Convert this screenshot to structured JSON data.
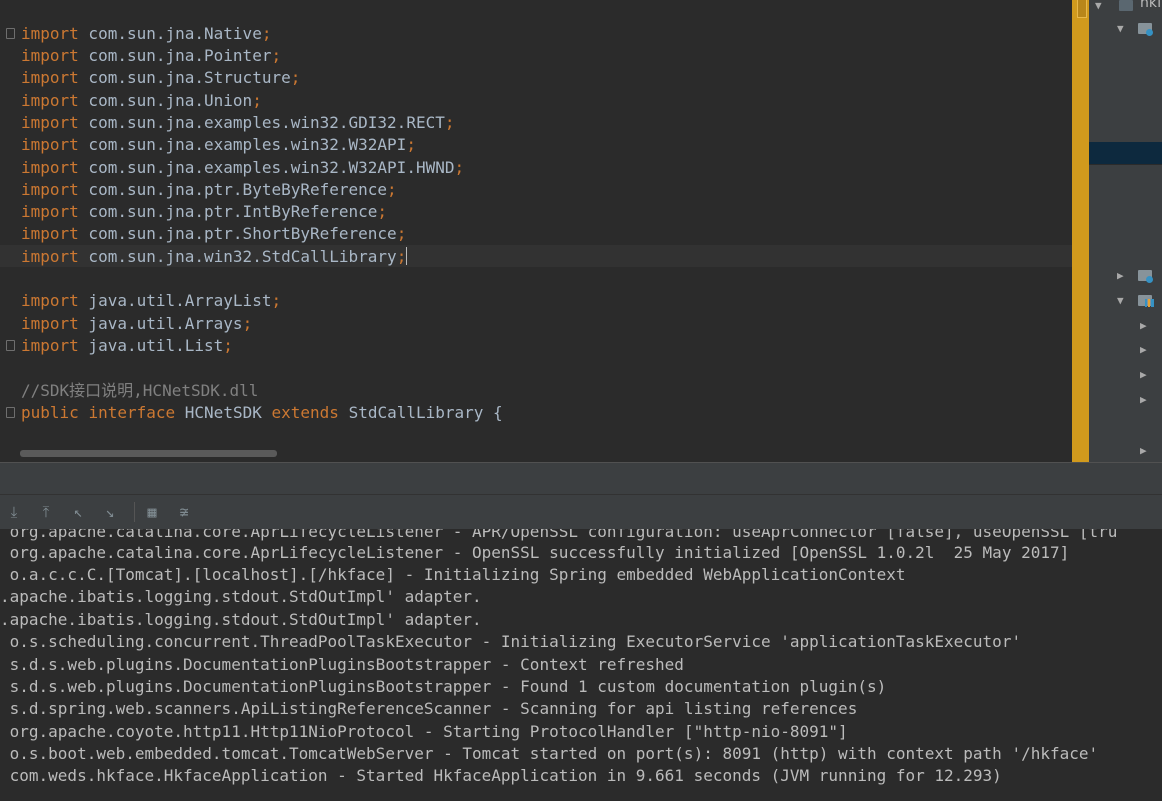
{
  "editor": {
    "lines": [
      {
        "kw": "import",
        "text": " com.sun.jna.Native",
        "semi": ";"
      },
      {
        "kw": "import",
        "text": " com.sun.jna.Pointer",
        "semi": ";"
      },
      {
        "kw": "import",
        "text": " com.sun.jna.Structure",
        "semi": ";"
      },
      {
        "kw": "import",
        "text": " com.sun.jna.Union",
        "semi": ";"
      },
      {
        "kw": "import",
        "text": " com.sun.jna.examples.win32.GDI32.RECT",
        "semi": ";"
      },
      {
        "kw": "import",
        "text": " com.sun.jna.examples.win32.W32API",
        "semi": ";"
      },
      {
        "kw": "import",
        "text": " com.sun.jna.examples.win32.W32API.HWND",
        "semi": ";"
      },
      {
        "kw": "import",
        "text": " com.sun.jna.ptr.ByteByReference",
        "semi": ";"
      },
      {
        "kw": "import",
        "text": " com.sun.jna.ptr.IntByReference",
        "semi": ";"
      },
      {
        "kw": "import",
        "text": " com.sun.jna.ptr.ShortByReference",
        "semi": ";"
      },
      {
        "kw": "import",
        "text": " com.sun.jna.win32.StdCallLibrary",
        "semi": ";"
      },
      {
        "kw": "import",
        "text": " java.util.ArrayList",
        "semi": ";"
      },
      {
        "kw": "import",
        "text": " java.util.Arrays",
        "semi": ";"
      },
      {
        "kw": "import",
        "text": " java.util.List",
        "semi": ";"
      }
    ],
    "comment": "//SDK接口说明,HCNetSDK.dll",
    "decl": {
      "kw1": "public",
      "kw2": "interface",
      "name": "HCNetSDK",
      "kw3": "extends",
      "parent": "StdCallLibrary {"
    }
  },
  "project_tree": {
    "root_label": "hkf"
  },
  "toolbar": {
    "icons": [
      "import-icon",
      "export-icon",
      "restore-icon",
      "scroll-to-end-icon",
      "print-icon",
      "soft-wrap-icon"
    ]
  },
  "console": {
    "lines": [
      " org.apache.catalina.core.AprLifecycleListener - APR/OpenSSL configuration: useAprConnector [false], useOpenSSL [tru",
      " org.apache.catalina.core.AprLifecycleListener - OpenSSL successfully initialized [OpenSSL 1.0.2l  25 May 2017]",
      " o.a.c.c.C.[Tomcat].[localhost].[/hkface] - Initializing Spring embedded WebApplicationContext",
      ".apache.ibatis.logging.stdout.StdOutImpl' adapter.",
      ".apache.ibatis.logging.stdout.StdOutImpl' adapter.",
      " o.s.scheduling.concurrent.ThreadPoolTaskExecutor - Initializing ExecutorService 'applicationTaskExecutor'",
      " s.d.s.web.plugins.DocumentationPluginsBootstrapper - Context refreshed",
      " s.d.s.web.plugins.DocumentationPluginsBootstrapper - Found 1 custom documentation plugin(s)",
      " s.d.spring.web.scanners.ApiListingReferenceScanner - Scanning for api listing references",
      " org.apache.coyote.http11.Http11NioProtocol - Starting ProtocolHandler [\"http-nio-8091\"]",
      " o.s.boot.web.embedded.tomcat.TomcatWebServer - Tomcat started on port(s): 8091 (http) with context path '/hkface'",
      " com.weds.hkface.HkfaceApplication - Started HkfaceApplication in 9.661 seconds (JVM running for 12.293)"
    ]
  }
}
